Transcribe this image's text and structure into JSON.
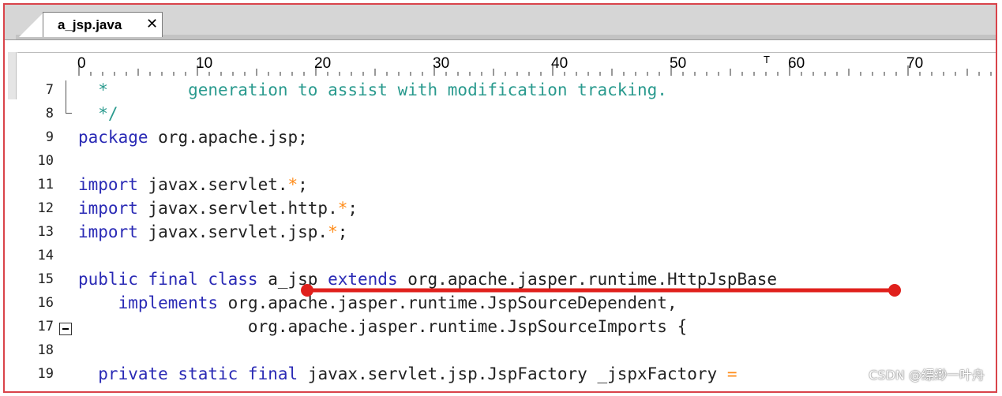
{
  "editor": {
    "tab": {
      "label": "a_jsp.java",
      "close": "✕"
    },
    "ruler": {
      "labels": [
        "0",
        "10",
        "20",
        "30",
        "40",
        "50",
        "60",
        "70"
      ],
      "marker": "T"
    },
    "lines": [
      {
        "num": "7",
        "segments": [
          {
            "t": "  *        generation to assist with modification tracking.",
            "c": "cm"
          }
        ]
      },
      {
        "num": "8",
        "segments": [
          {
            "t": "  */",
            "c": "cm"
          }
        ]
      },
      {
        "num": "9",
        "segments": [
          {
            "t": "package",
            "c": "kw"
          },
          {
            "t": " org.apache.jsp;",
            "c": ""
          }
        ]
      },
      {
        "num": "10",
        "segments": []
      },
      {
        "num": "11",
        "segments": [
          {
            "t": "import",
            "c": "kw"
          },
          {
            "t": " javax.servlet.",
            "c": ""
          },
          {
            "t": "*",
            "c": "op"
          },
          {
            "t": ";",
            "c": ""
          }
        ]
      },
      {
        "num": "12",
        "segments": [
          {
            "t": "import",
            "c": "kw"
          },
          {
            "t": " javax.servlet.http.",
            "c": ""
          },
          {
            "t": "*",
            "c": "op"
          },
          {
            "t": ";",
            "c": ""
          }
        ]
      },
      {
        "num": "13",
        "segments": [
          {
            "t": "import",
            "c": "kw"
          },
          {
            "t": " javax.servlet.jsp.",
            "c": ""
          },
          {
            "t": "*",
            "c": "op"
          },
          {
            "t": ";",
            "c": ""
          }
        ]
      },
      {
        "num": "14",
        "segments": []
      },
      {
        "num": "15",
        "segments": [
          {
            "t": "public final class",
            "c": "kw"
          },
          {
            "t": " a_jsp ",
            "c": ""
          },
          {
            "t": "extends",
            "c": "kw"
          },
          {
            "t": " org.apache.jasper.runtime.HttpJspBase",
            "c": ""
          }
        ]
      },
      {
        "num": "16",
        "segments": [
          {
            "t": "    implements",
            "c": "kw"
          },
          {
            "t": " org.apache.jasper.runtime.JspSourceDependent,",
            "c": ""
          }
        ]
      },
      {
        "num": "17",
        "segments": [
          {
            "t": "                 org.apache.jasper.runtime.JspSourceImports {",
            "c": ""
          }
        ]
      },
      {
        "num": "18",
        "segments": []
      },
      {
        "num": "19",
        "segments": [
          {
            "t": "  private static final",
            "c": "kw"
          },
          {
            "t": " javax.servlet.jsp.JspFactory _jspxFactory ",
            "c": ""
          },
          {
            "t": "=",
            "c": "op"
          }
        ]
      }
    ]
  },
  "colors": {
    "keyword": "#2a2ab5",
    "comment": "#2a9a8e",
    "operator": "#ff8c1a",
    "annotation": "#e0201c",
    "frame": "#d9434a"
  },
  "watermark": "CSDN @缥缈一叶舟"
}
